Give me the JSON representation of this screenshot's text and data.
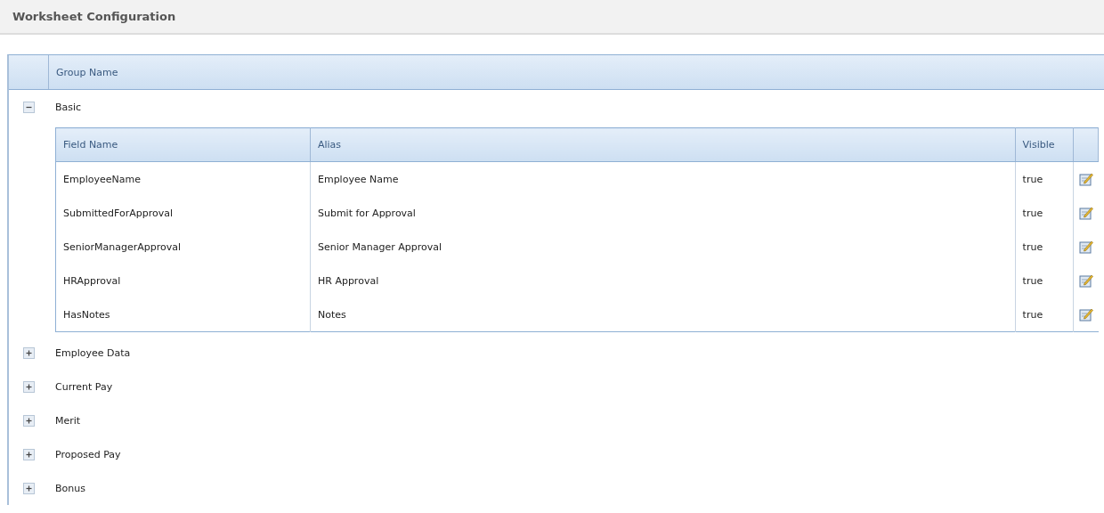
{
  "page_title": "Worksheet Configuration",
  "grid": {
    "columns": [
      "Group Name"
    ],
    "groups": [
      {
        "name": "Basic",
        "expanded": true,
        "fields": {
          "columns": [
            "Field Name",
            "Alias",
            "Visible"
          ],
          "rows": [
            {
              "field_name": "EmployeeName",
              "alias": "Employee Name",
              "visible": "true"
            },
            {
              "field_name": "SubmittedForApproval",
              "alias": "Submit for Approval",
              "visible": "true"
            },
            {
              "field_name": "SeniorManagerApproval",
              "alias": "Senior Manager Approval",
              "visible": "true"
            },
            {
              "field_name": "HRApproval",
              "alias": "HR Approval",
              "visible": "true"
            },
            {
              "field_name": "HasNotes",
              "alias": "Notes",
              "visible": "true"
            }
          ]
        }
      },
      {
        "name": "Employee Data",
        "expanded": false
      },
      {
        "name": "Current Pay",
        "expanded": false
      },
      {
        "name": "Merit",
        "expanded": false
      },
      {
        "name": "Proposed Pay",
        "expanded": false
      },
      {
        "name": "Bonus",
        "expanded": false
      }
    ]
  }
}
